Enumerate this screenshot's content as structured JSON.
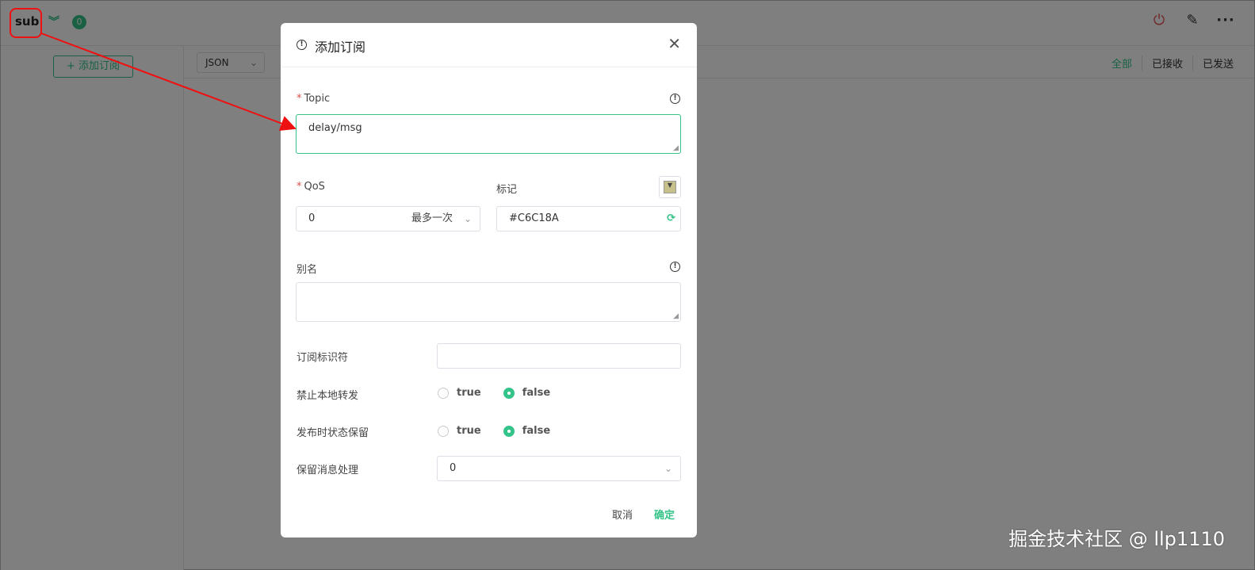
{
  "connection": {
    "name": "sub",
    "unread_count": "0"
  },
  "sidebar": {
    "add_subscription_label": "添加订阅"
  },
  "toolbar": {
    "payload_format": "JSON",
    "filters": [
      "全部",
      "已接收",
      "已发送"
    ]
  },
  "dialog": {
    "title": "添加订阅",
    "topic": {
      "label": "Topic",
      "value": "delay/msg"
    },
    "qos": {
      "label": "QoS",
      "value": "0",
      "description": "最多一次"
    },
    "tag": {
      "label": "标记",
      "value": "#C6C18A",
      "swatch_color": "#C6C18A"
    },
    "alias": {
      "label": "别名",
      "value": ""
    },
    "sub_identifier": {
      "label": "订阅标识符",
      "value": ""
    },
    "no_local": {
      "label": "禁止本地转发",
      "options": [
        "true",
        "false"
      ],
      "selected": "false"
    },
    "retain_as_published": {
      "label": "发布时状态保留",
      "options": [
        "true",
        "false"
      ],
      "selected": "false"
    },
    "retain_handling": {
      "label": "保留消息处理",
      "value": "0"
    },
    "cancel_label": "取消",
    "confirm_label": "确定"
  },
  "watermark": "掘金技术社区 @ llp1110",
  "colors": {
    "accent": "#34c388",
    "danger": "#e24d4d",
    "annotation": "#ee1111"
  }
}
